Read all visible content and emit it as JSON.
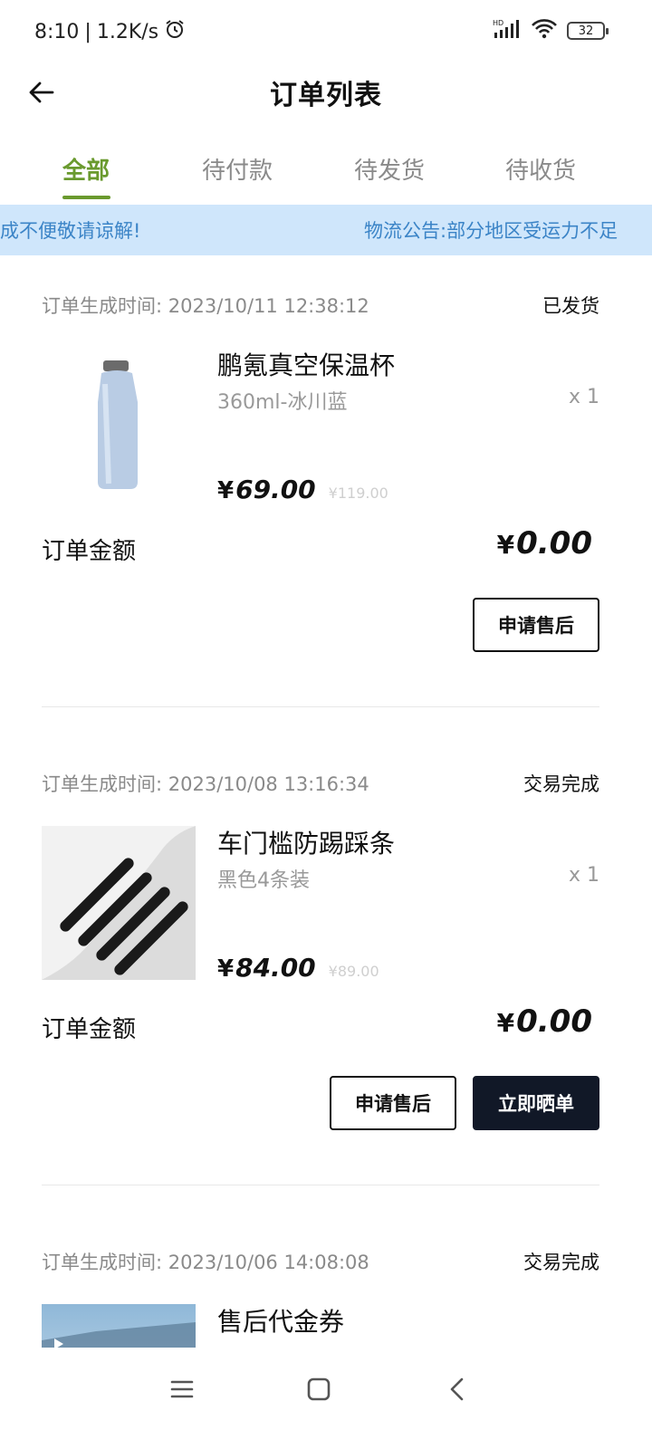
{
  "status_bar": {
    "time": "8:10",
    "speed": "1.2K/s",
    "battery": "32"
  },
  "header": {
    "title": "订单列表"
  },
  "tabs": [
    {
      "label": "全部",
      "active": true
    },
    {
      "label": "待付款",
      "active": false
    },
    {
      "label": "待发货",
      "active": false
    },
    {
      "label": "待收货",
      "active": false
    }
  ],
  "notice": {
    "tail_text": "成不便敬请谅解!",
    "text": "物流公告:部分地区受运力不足"
  },
  "orders": [
    {
      "time_label": "订单生成时间: 2023/10/11 12:38:12",
      "status": "已发货",
      "product_name": "鹏氪真空保温杯",
      "spec": "360ml-冰川蓝",
      "qty": "x 1",
      "currency": "¥",
      "price": "69.00",
      "original_price": "¥119.00",
      "amount_label": "订单金额",
      "amount": "0.00",
      "buttons": [
        "申请售后"
      ]
    },
    {
      "time_label": "订单生成时间: 2023/10/08 13:16:34",
      "status": "交易完成",
      "product_name": "车门槛防踢踩条",
      "spec": "黑色4条装",
      "qty": "x 1",
      "currency": "¥",
      "price": "84.00",
      "original_price": "¥89.00",
      "amount_label": "订单金额",
      "amount": "0.00",
      "buttons": [
        "申请售后",
        "立即晒单"
      ]
    },
    {
      "time_label": "订单生成时间: 2023/10/06 14:08:08",
      "status": "交易完成",
      "product_name": "售后代金券"
    }
  ],
  "colors": {
    "accent": "#6a9a2e",
    "notice_bg": "#cfe6fb",
    "notice_text": "#3b84c7",
    "dark_button": "#111827"
  }
}
